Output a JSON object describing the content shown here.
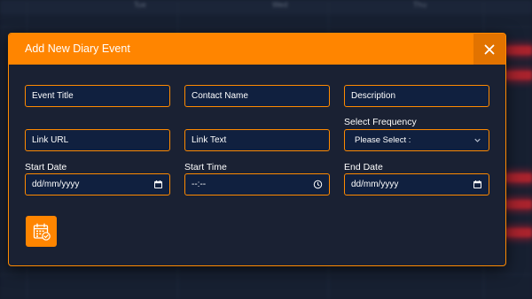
{
  "background": {
    "columns": [
      "Tue",
      "Wed",
      "Thu"
    ]
  },
  "modal": {
    "title": "Add New Diary Event",
    "close_label": "X",
    "fields": {
      "event_title": {
        "placeholder": "Event Title"
      },
      "contact_name": {
        "placeholder": "Contact Name"
      },
      "description": {
        "placeholder": "Description"
      },
      "link_url": {
        "placeholder": "Link URL"
      },
      "link_text": {
        "placeholder": "Link Text"
      },
      "frequency": {
        "label": "Select Frequency",
        "value": "Please Select :"
      },
      "start_date": {
        "label": "Start Date",
        "value": "dd/mm/yyyy"
      },
      "start_time": {
        "label": "Start Time",
        "value": "--:--"
      },
      "end_date": {
        "label": "End Date",
        "value": "dd/mm/yyyy"
      }
    }
  },
  "colors": {
    "accent": "#ff8500",
    "modal_bg": "#1a2133",
    "field_bg": "#10203f"
  }
}
